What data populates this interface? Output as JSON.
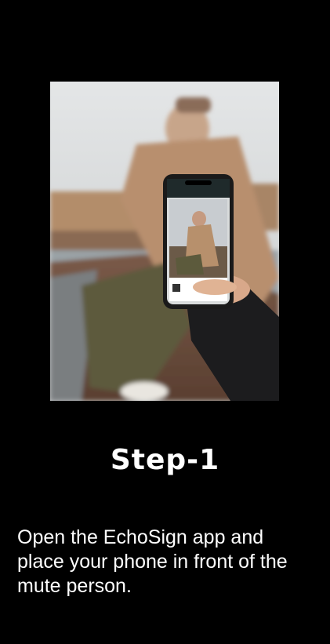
{
  "onboarding": {
    "image_description_icon": "person-holding-phone-photo",
    "title": "Step-1",
    "description": "Open the EchoSign app and place your phone in front of the mute person."
  },
  "colors": {
    "background": "#000000",
    "text": "#ffffff"
  }
}
